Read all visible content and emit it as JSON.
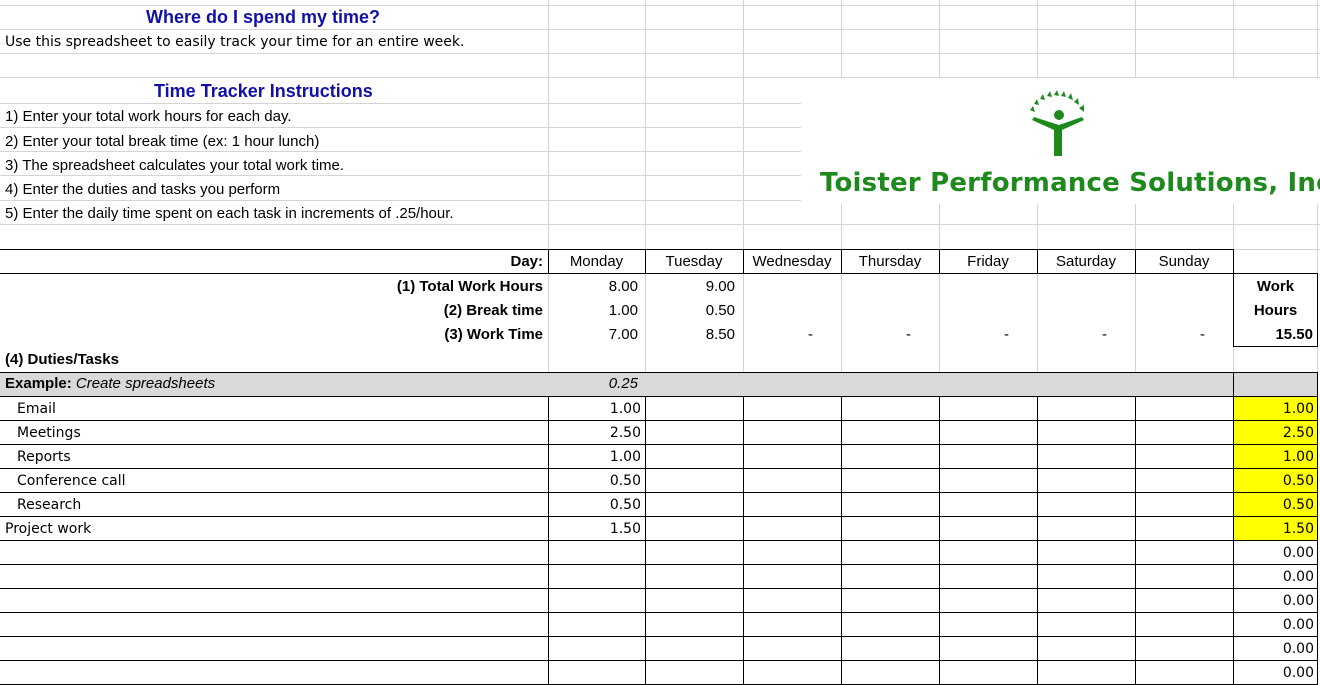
{
  "header": {
    "title": "Where do I spend my time?",
    "subtitle": "Use this spreadsheet to easily track your time for an entire week."
  },
  "instructions": {
    "title": "Time Tracker Instructions",
    "steps": [
      "1) Enter your total work hours for each day.",
      "2) Enter your total break time (ex: 1 hour lunch)",
      "3) The spreadsheet calculates your total work time.",
      "4) Enter the duties and tasks you perform",
      "5) Enter the daily time spent on each task in increments of .25/hour."
    ]
  },
  "logo": {
    "company": "Toister Performance Solutions, Inc.",
    "icon": "person-with-sunburst-icon",
    "color": "#1e8a1e"
  },
  "table": {
    "day_label": "Day:",
    "days": [
      "Monday",
      "Tuesday",
      "Wednesday",
      "Thursday",
      "Friday",
      "Saturday",
      "Sunday"
    ],
    "rows": {
      "total_work_hours": {
        "label": "(1) Total Work Hours",
        "values": [
          "8.00",
          "9.00",
          "",
          "",
          "",
          "",
          ""
        ]
      },
      "break_time": {
        "label": "(2) Break time",
        "values": [
          "1.00",
          "0.50",
          "",
          "",
          "",
          "",
          ""
        ]
      },
      "work_time": {
        "label": "(3) Work Time",
        "values": [
          "7.00",
          "8.50",
          "-",
          "-",
          "-",
          "-",
          "-"
        ]
      }
    },
    "work_hours_box": {
      "line1": "Work",
      "line2": "Hours",
      "total": "15.50"
    },
    "duties_label": "(4) Duties/Tasks",
    "example": {
      "prefix": "Example:",
      "text": "Create spreadsheets",
      "monday": "0.25"
    },
    "tasks": [
      {
        "name": "Email",
        "monday": "1.00",
        "total": "1.00"
      },
      {
        "name": "Meetings",
        "monday": "2.50",
        "total": "2.50"
      },
      {
        "name": "Reports",
        "monday": "1.00",
        "total": "1.00"
      },
      {
        "name": "Conference call",
        "monday": "0.50",
        "total": "0.50"
      },
      {
        "name": "Research",
        "monday": "0.50",
        "total": "0.50"
      },
      {
        "name": "Project work",
        "monday": "1.50",
        "total": "1.50"
      },
      {
        "name": "",
        "monday": "",
        "total": "0.00"
      },
      {
        "name": "",
        "monday": "",
        "total": "0.00"
      },
      {
        "name": "",
        "monday": "",
        "total": "0.00"
      },
      {
        "name": "",
        "monday": "",
        "total": "0.00"
      },
      {
        "name": "",
        "monday": "",
        "total": "0.00"
      },
      {
        "name": "",
        "monday": "",
        "total": "0.00"
      }
    ],
    "highlight_color": "#ffff00",
    "example_shade": "#d9d9d9"
  }
}
